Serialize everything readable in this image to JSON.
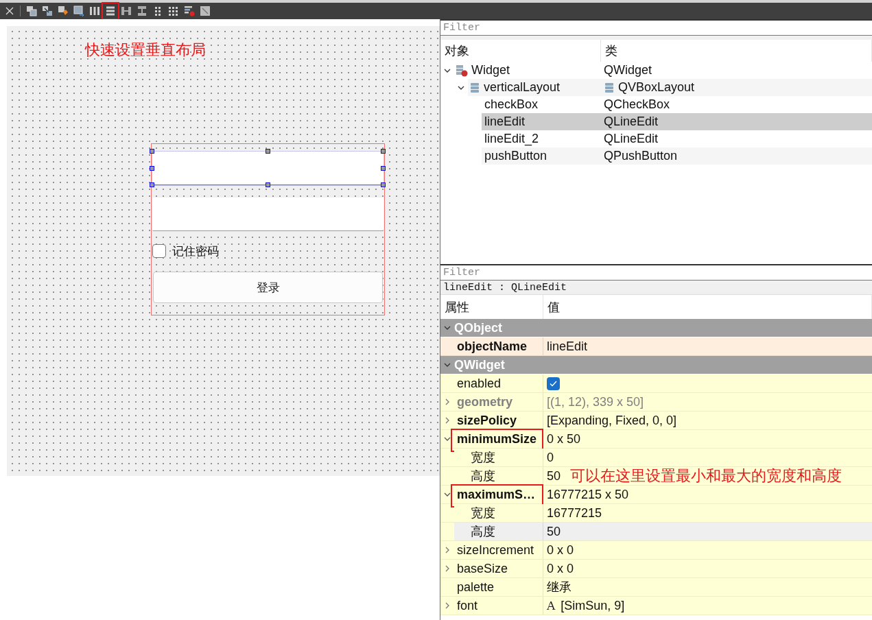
{
  "toolbar": {
    "buttons": [
      {
        "kind": "close",
        "highlighted": false
      },
      {
        "kind": "edit-widgets",
        "highlighted": false
      },
      {
        "kind": "edit-signals",
        "highlighted": false
      },
      {
        "kind": "edit-buddies",
        "highlighted": false
      },
      {
        "kind": "edit-tab-order",
        "highlighted": false
      },
      {
        "kind": "layout-horizontal",
        "highlighted": false
      },
      {
        "kind": "layout-vertical",
        "highlighted": true
      },
      {
        "kind": "splitter-horizontal",
        "highlighted": false
      },
      {
        "kind": "splitter-vertical",
        "highlighted": false
      },
      {
        "kind": "layout-form",
        "highlighted": false
      },
      {
        "kind": "layout-grid",
        "highlighted": false
      },
      {
        "kind": "break-layout",
        "highlighted": false
      },
      {
        "kind": "adjust-size",
        "highlighted": false
      }
    ]
  },
  "canvas": {
    "annotation": "快速设置垂直布局",
    "form": {
      "line_edits": [
        {
          "selected": true
        },
        {
          "selected": false
        }
      ],
      "checkbox": {
        "label": "记住密码",
        "checked": false
      },
      "button": {
        "label": "登录"
      }
    }
  },
  "object_inspector": {
    "filter_placeholder": "Filter",
    "columns": [
      "对象",
      "类"
    ],
    "tree": [
      {
        "name": "Widget",
        "class": "QWidget",
        "kind": "form",
        "expanded": true,
        "selected": false,
        "children": [
          {
            "name": "verticalLayout",
            "class": "QVBoxLayout",
            "kind": "layout",
            "expanded": true,
            "selected": false,
            "children": [
              {
                "name": "checkBox",
                "class": "QCheckBox",
                "kind": "widget",
                "selected": false
              },
              {
                "name": "lineEdit",
                "class": "QLineEdit",
                "kind": "widget",
                "selected": true
              },
              {
                "name": "lineEdit_2",
                "class": "QLineEdit",
                "kind": "widget",
                "selected": false
              },
              {
                "name": "pushButton",
                "class": "QPushButton",
                "kind": "widget",
                "selected": false
              }
            ]
          }
        ]
      }
    ]
  },
  "property_editor": {
    "filter_placeholder": "Filter",
    "object_label": "lineEdit : QLineEdit",
    "columns": [
      "属性",
      "值"
    ],
    "groups": [
      {
        "name": "QObject",
        "expanded": true,
        "color": "#fdeedd",
        "properties": [
          {
            "name": "objectName",
            "kind": "text",
            "value": "lineEdit",
            "modified": true,
            "disabled": false,
            "selected": false,
            "highlighted": false
          }
        ]
      },
      {
        "name": "QWidget",
        "expanded": true,
        "color": "#ffffd6",
        "properties": [
          {
            "name": "enabled",
            "kind": "checkbox",
            "checked": true,
            "modified": false,
            "disabled": false,
            "selected": false,
            "highlighted": false
          },
          {
            "name": "geometry",
            "kind": "text",
            "value": "[(1, 12), 339 x 50]",
            "modified": true,
            "disabled": true,
            "expanded": false,
            "selected": false,
            "highlighted": false
          },
          {
            "name": "sizePolicy",
            "kind": "text",
            "value": "[Expanding, Fixed, 0, 0]",
            "modified": true,
            "disabled": false,
            "expanded": false,
            "selected": false,
            "highlighted": false
          },
          {
            "name": "minimumSize",
            "kind": "text",
            "value": "0 x 50",
            "modified": true,
            "disabled": false,
            "expanded": true,
            "selected": false,
            "highlighted": true,
            "children": [
              {
                "name": "宽度",
                "kind": "text",
                "value": "0",
                "modified": false,
                "disabled": false,
                "selected": false,
                "highlighted": false
              },
              {
                "name": "高度",
                "kind": "text",
                "value": "50",
                "annotation": "可以在这里设置最小和最大的宽度和高度",
                "modified": false,
                "disabled": false,
                "selected": false,
                "highlighted": false
              }
            ]
          },
          {
            "name": "maximumS…",
            "kind": "text",
            "value": "16777215 x 50",
            "modified": true,
            "disabled": false,
            "expanded": true,
            "selected": false,
            "highlighted": true,
            "children": [
              {
                "name": "宽度",
                "kind": "text",
                "value": "16777215",
                "modified": false,
                "disabled": false,
                "selected": false,
                "highlighted": false
              },
              {
                "name": "高度",
                "kind": "text",
                "value": "50",
                "modified": false,
                "disabled": false,
                "selected": true,
                "highlighted": false
              }
            ]
          },
          {
            "name": "sizeIncrement",
            "kind": "text",
            "value": "0 x 0",
            "modified": false,
            "disabled": false,
            "expanded": false,
            "selected": false,
            "highlighted": false
          },
          {
            "name": "baseSize",
            "kind": "text",
            "value": "0 x 0",
            "modified": false,
            "disabled": false,
            "expanded": false,
            "selected": false,
            "highlighted": false
          },
          {
            "name": "palette",
            "kind": "text",
            "value": "继承",
            "modified": false,
            "disabled": false,
            "selected": false,
            "highlighted": false
          },
          {
            "name": "font",
            "kind": "font",
            "glyph": "A",
            "value": "[SimSun, 9]",
            "modified": false,
            "disabled": false,
            "expanded": false,
            "selected": false,
            "highlighted": false
          }
        ]
      }
    ]
  }
}
